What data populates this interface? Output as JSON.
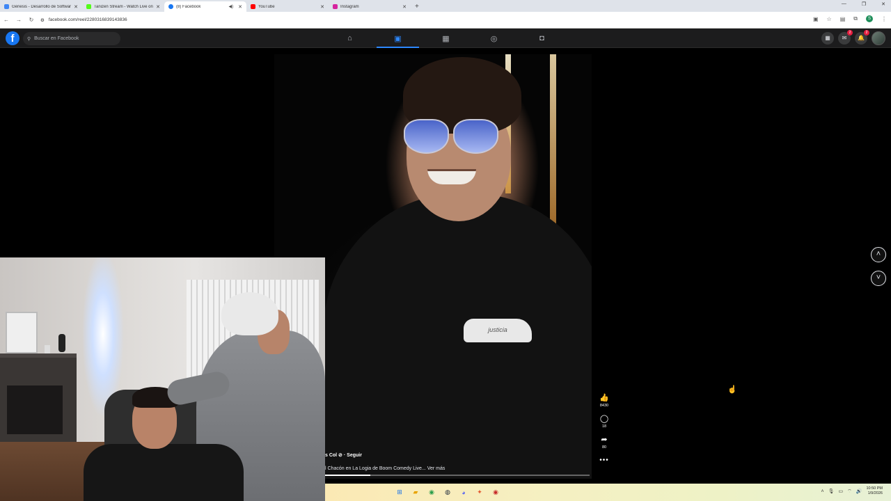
{
  "browser": {
    "tabs": [
      {
        "title": "Génesis - Desarrollo de Software",
        "color": "#3e86f5",
        "active": false,
        "muted_icon": false
      },
      {
        "title": "Tanizen Stream - Watch Live on",
        "color": "#53fc18",
        "active": false,
        "muted_icon": false
      },
      {
        "title": "(8) Facebook",
        "color": "#1877f2",
        "active": true,
        "muted_icon": true
      },
      {
        "title": "YouTube",
        "color": "#ff0000",
        "active": false,
        "muted_icon": false
      },
      {
        "title": "Instagram",
        "color": "#d6249f",
        "active": false,
        "muted_icon": false
      }
    ],
    "new_tab": "+",
    "url": "facebook.com/reel/2280316839143836"
  },
  "facebook": {
    "logo": "f",
    "search_placeholder": "Buscar en Facebook",
    "nav_icons": [
      "home-icon",
      "reels-icon",
      "marketplace-icon",
      "groups-icon",
      "gaming-icon"
    ],
    "active_nav": "reels-icon",
    "messenger_badge": "2",
    "notifications_badge": "2",
    "accent_color": "#2d88ff"
  },
  "reel": {
    "author": "s Col ⊘ · Seguir",
    "caption": "l Chacón en La Logia de Boom Comedy Live... Ver más",
    "progress": 0.17,
    "shirt_text": "justicia",
    "likes": "8430",
    "comments": "18",
    "shares": "80",
    "more": "•••"
  },
  "taskbar": {
    "apps": [
      "windows-icon",
      "file-explorer-icon",
      "chrome-icon",
      "steam-icon",
      "discord-icon",
      "app-icon",
      "chrome-dev-icon"
    ],
    "time": "10:50 PM",
    "date": "1/9/2026"
  }
}
